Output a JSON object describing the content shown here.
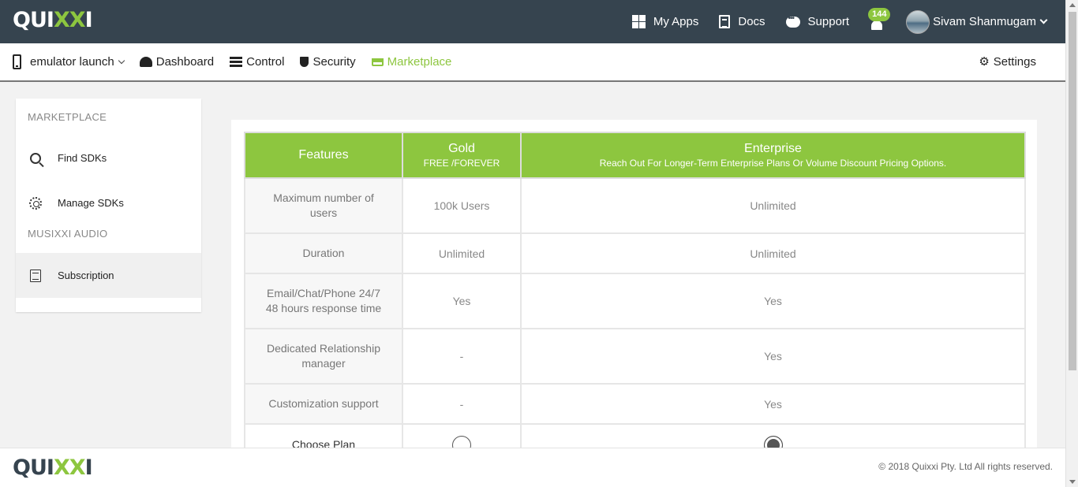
{
  "brand": {
    "logo_prefix": "QUI",
    "logo_x": "XX",
    "logo_suffix": "I"
  },
  "topnav": {
    "my_apps": "My Apps",
    "docs": "Docs",
    "support": "Support",
    "notifications_count": "144",
    "user_name": "Sivam Shanmugam"
  },
  "subnav": {
    "app_name": "emulator launch",
    "dashboard": "Dashboard",
    "control": "Control",
    "security": "Security",
    "marketplace": "Marketplace",
    "settings": "Settings"
  },
  "sidebar": {
    "heading_marketplace": "MARKETPLACE",
    "find_sdks": "Find SDKs",
    "manage_sdks": "Manage SDKs",
    "heading_app": "MUSIXXI AUDIO",
    "subscription": "Subscription"
  },
  "plans": {
    "headers": {
      "features": "Features",
      "gold_name": "Gold",
      "gold_sub": "FREE /FOREVER",
      "enterprise_name": "Enterprise",
      "enterprise_sub": "Reach Out For Longer-Term Enterprise Plans Or Volume Discount Pricing Options."
    },
    "rows": [
      {
        "feature": "Maximum number of users",
        "gold": "100k Users",
        "enterprise": "Unlimited"
      },
      {
        "feature": "Duration",
        "gold": "Unlimited",
        "enterprise": "Unlimited"
      },
      {
        "feature": "Email/Chat/Phone 24/7 48 hours response time",
        "gold": "Yes",
        "enterprise": "Yes"
      },
      {
        "feature": "Dedicated Relationship manager",
        "gold": "-",
        "enterprise": "Yes"
      },
      {
        "feature": "Customization support",
        "gold": "-",
        "enterprise": "Yes"
      }
    ],
    "choose_plan_label": "Choose Plan",
    "selected_plan": "Enterprise"
  },
  "footer": {
    "copyright": "© 2018 Quixxi Pty. Ltd All rights reserved."
  },
  "colors": {
    "accent": "#8dc63f",
    "topbar": "#36444f"
  }
}
